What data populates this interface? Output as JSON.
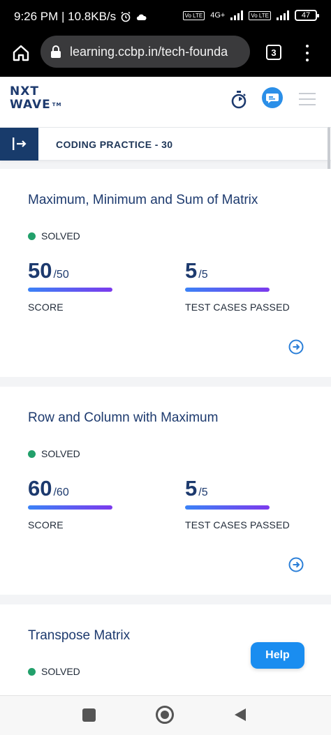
{
  "status_bar": {
    "time_speed": "9:26 PM | 10.8KB/s",
    "network": "4G+",
    "sim1_badge": "Vo LTE",
    "sim2_badge": "Vo LTE",
    "battery": "47"
  },
  "browser": {
    "url": "learning.ccbp.in/tech-founda",
    "tab_count": "3"
  },
  "app_header": {
    "logo_line1": "NXT",
    "logo_line2": "WAVE",
    "logo_tm": "TM"
  },
  "section": {
    "title": "CODING PRACTICE - 30"
  },
  "cards": [
    {
      "title": "Maximum, Minimum and Sum of Matrix",
      "status": "SOLVED",
      "score": "50",
      "score_total": "/50",
      "score_label": "SCORE",
      "tests": "5",
      "tests_total": "/5",
      "tests_label": "TEST CASES PASSED"
    },
    {
      "title": "Row and Column with Maximum",
      "status": "SOLVED",
      "score": "60",
      "score_total": "/60",
      "score_label": "SCORE",
      "tests": "5",
      "tests_total": "/5",
      "tests_label": "TEST CASES PASSED"
    },
    {
      "title": "Transpose Matrix",
      "status": "SOLVED"
    }
  ],
  "help_button": "Help",
  "colors": {
    "brand_navy": "#1d3a6e",
    "solved_green": "#22a06b",
    "progress_start": "#3b82f6",
    "progress_end": "#7c3aed",
    "help_blue": "#1a8df0"
  }
}
